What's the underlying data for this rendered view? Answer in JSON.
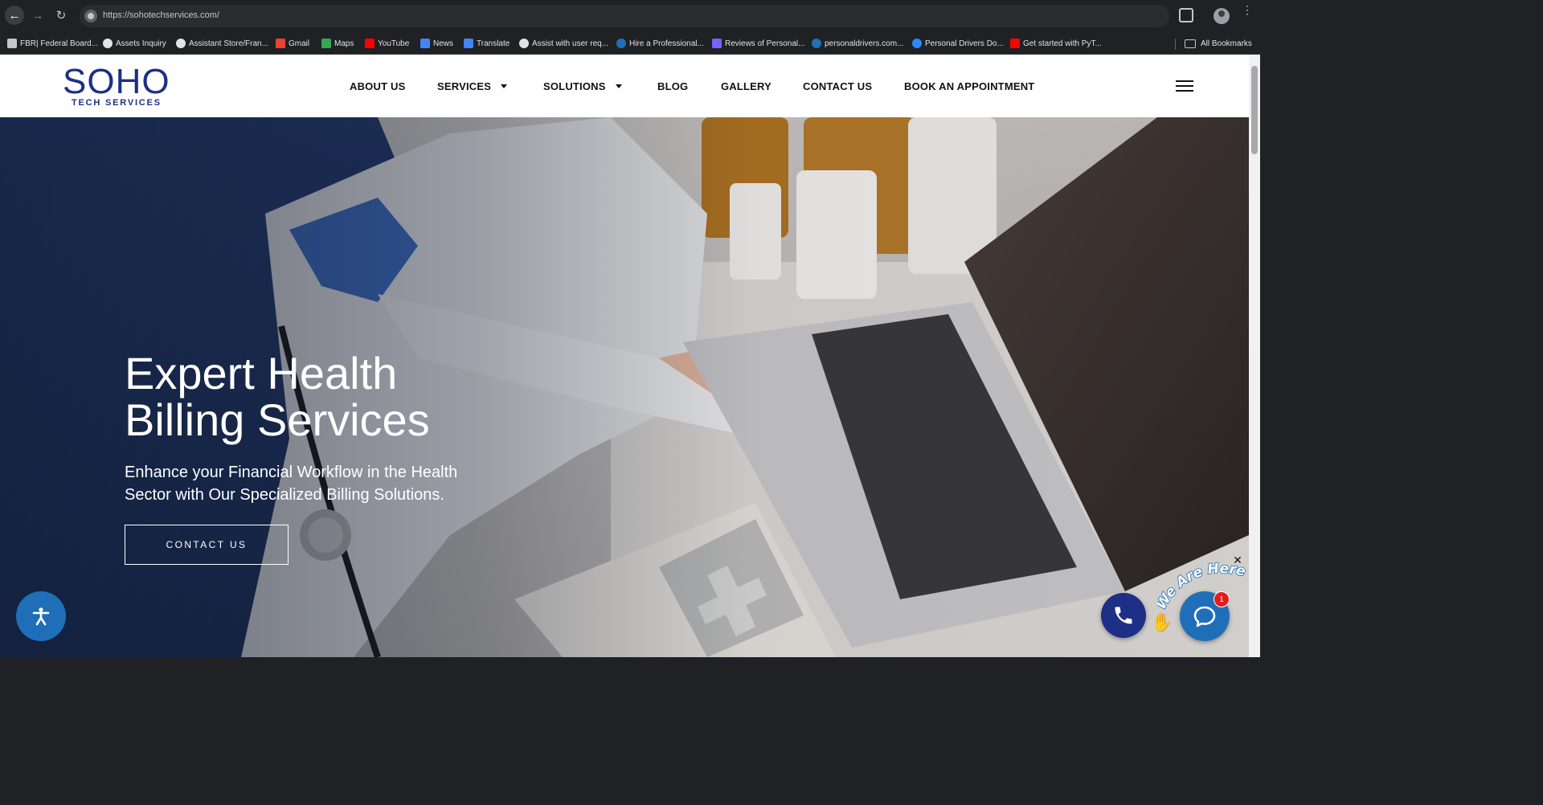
{
  "browser": {
    "url": "https://sohotechservices.com/",
    "bookmarks": [
      {
        "label": "FBR| Federal Board...",
        "color": "#c4c7c5"
      },
      {
        "label": "Assets Inquiry",
        "color": "#e3e3e3"
      },
      {
        "label": "Assistant Store/Fran...",
        "color": "#e3e3e3"
      },
      {
        "label": "Gmail",
        "color": "#ea4335"
      },
      {
        "label": "Maps",
        "color": "#34a853"
      },
      {
        "label": "YouTube",
        "color": "#ff0000"
      },
      {
        "label": "News",
        "color": "#4285f4"
      },
      {
        "label": "Translate",
        "color": "#4285f4"
      },
      {
        "label": "Assist with user req...",
        "color": "#e3e3e3"
      },
      {
        "label": "Hire a Professional...",
        "color": "#1f6fb8"
      },
      {
        "label": "Reviews of Personal...",
        "color": "#7b61ff"
      },
      {
        "label": "personaldrivers.com...",
        "color": "#1f6fb8"
      },
      {
        "label": "Personal Drivers Do...",
        "color": "#2b8af7"
      },
      {
        "label": "Get started with PyT...",
        "color": "#ff0000"
      }
    ],
    "all_bookmarks": "All Bookmarks"
  },
  "site": {
    "logo_main": "SOHO",
    "logo_sub": "TECH SERVICES",
    "nav": [
      {
        "label": "ABOUT US",
        "has_dropdown": false
      },
      {
        "label": "SERVICES",
        "has_dropdown": true
      },
      {
        "label": "SOLUTIONS",
        "has_dropdown": true
      },
      {
        "label": "BLOG",
        "has_dropdown": false
      },
      {
        "label": "GALLERY",
        "has_dropdown": false
      },
      {
        "label": "CONTACT US",
        "has_dropdown": false
      },
      {
        "label": "BOOK AN APPOINTMENT",
        "has_dropdown": false
      }
    ],
    "accent": "#1d2f86"
  },
  "hero": {
    "title_line1": "Expert Health",
    "title_line2": "Billing Services",
    "subtitle": "Enhance your Financial Workflow in the Health Sector with Our Specialized Billing Solutions.",
    "cta": "CONTACT US"
  },
  "widgets": {
    "chat_badge_count": "1",
    "chat_tagline": "We Are Here!",
    "accessibility_color": "#1f6fb8"
  }
}
